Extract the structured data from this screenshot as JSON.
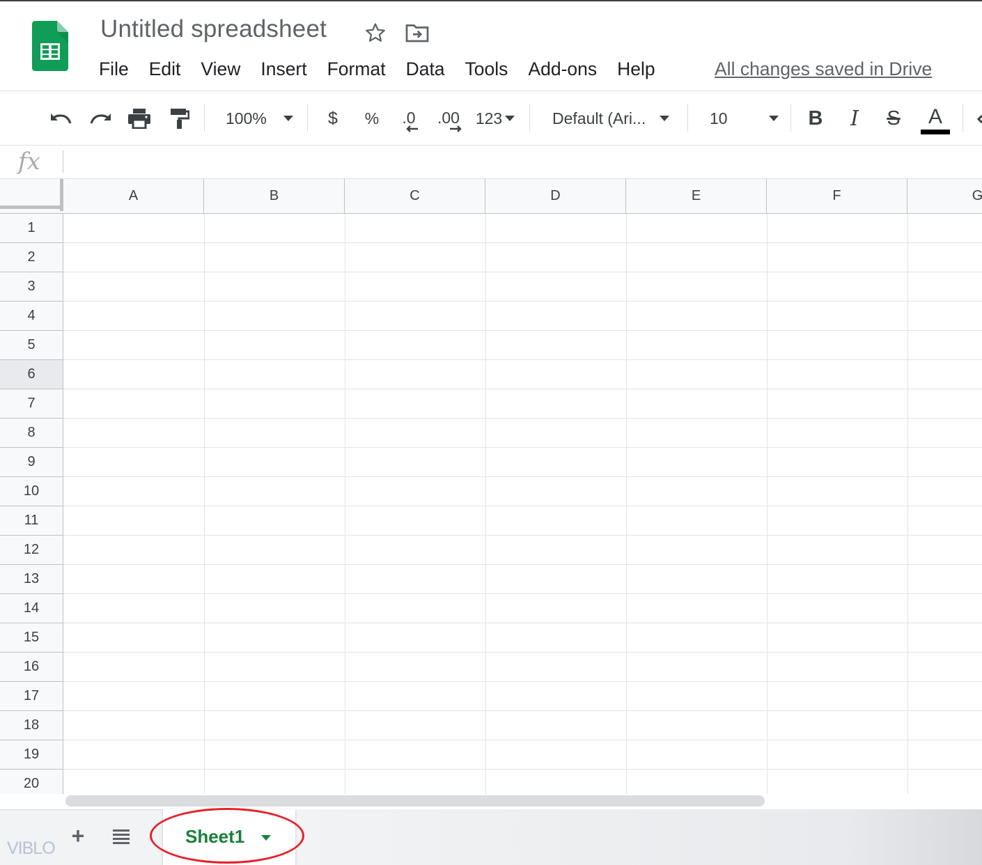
{
  "header": {
    "title": "Untitled spreadsheet",
    "save_status": "All changes saved in Drive",
    "menu": [
      "File",
      "Edit",
      "View",
      "Insert",
      "Format",
      "Data",
      "Tools",
      "Add-ons",
      "Help"
    ]
  },
  "toolbar": {
    "zoom": "100%",
    "currency": "$",
    "percent": "%",
    "decrease_decimal": ".0",
    "increase_decimal": ".00",
    "number_format": "123",
    "font_family": "Default (Ari...",
    "font_size": "10",
    "bold": "B",
    "italic": "I",
    "strikethrough": "S",
    "text_color": "A",
    "text_color_value": "#000000"
  },
  "formula_bar": {
    "label": "fx",
    "value": ""
  },
  "grid": {
    "columns": [
      "A",
      "B",
      "C",
      "D",
      "E",
      "F",
      "G"
    ],
    "rows": [
      "1",
      "2",
      "3",
      "4",
      "5",
      "6",
      "7",
      "8",
      "9",
      "10",
      "11",
      "12",
      "13",
      "14",
      "15",
      "16",
      "17",
      "18",
      "19",
      "20"
    ],
    "active_row": "6"
  },
  "sheets": {
    "tabs": [
      {
        "name": "Sheet1",
        "active": true
      }
    ],
    "add_label": "+"
  },
  "watermark": "VIBLO",
  "colors": {
    "brand_green": "#0f9d58",
    "active_tab_text": "#188038",
    "annotation": "#e8202a"
  }
}
